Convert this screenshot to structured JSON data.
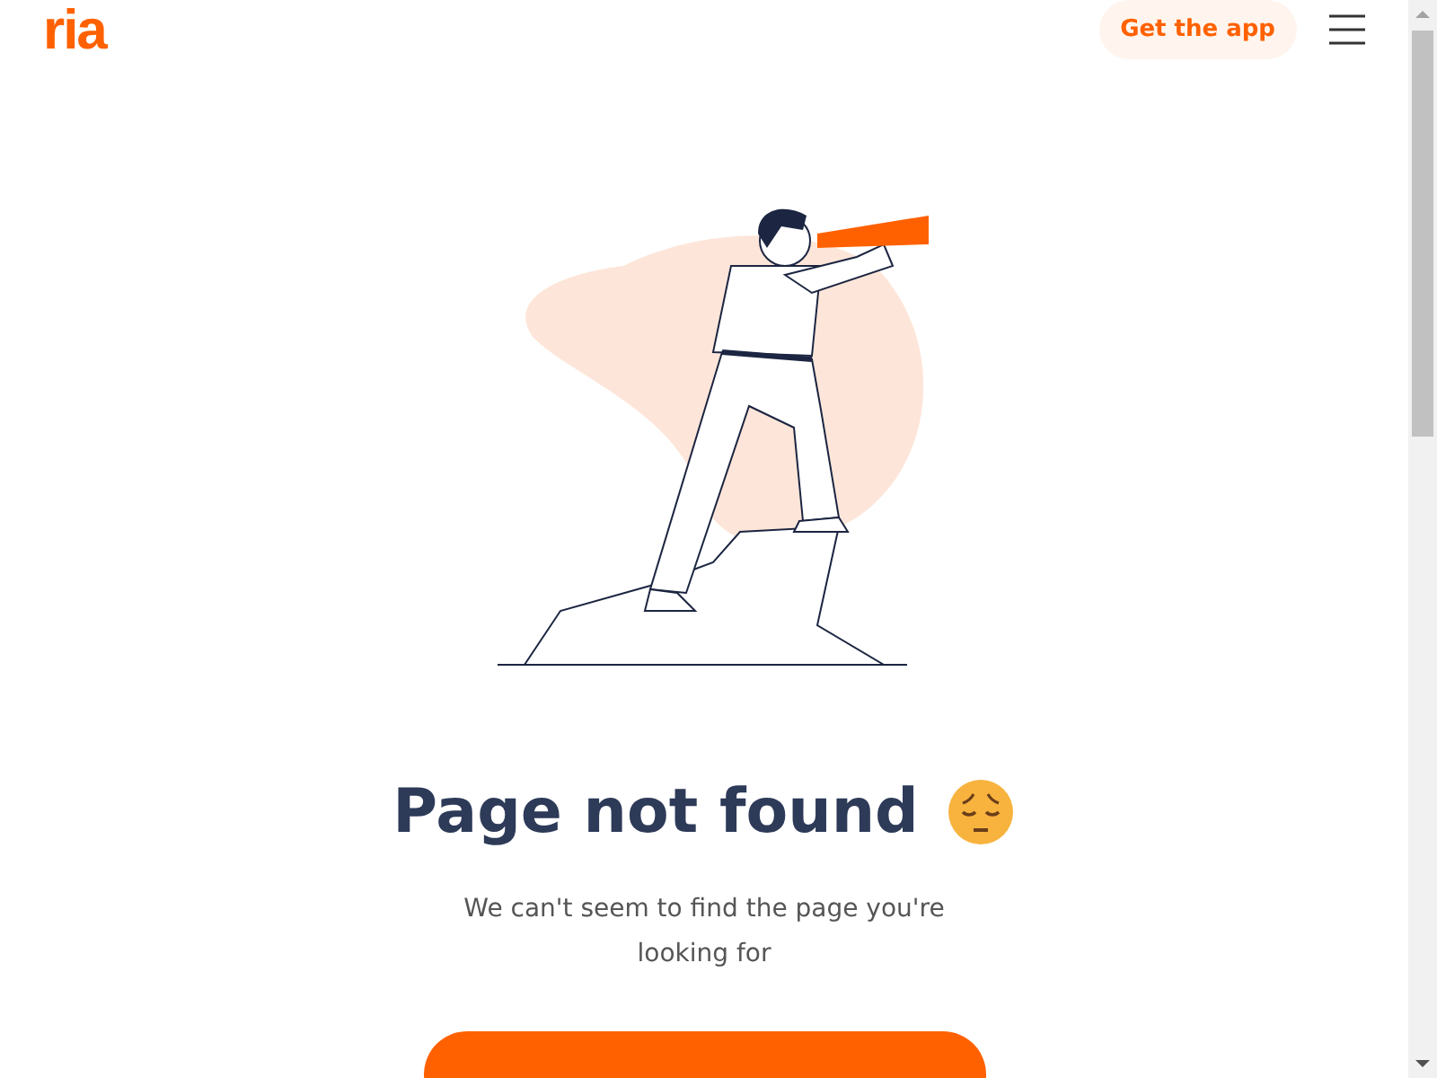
{
  "header": {
    "logo": "ria",
    "cta": "Get the app"
  },
  "error": {
    "title": "Page not found",
    "message": "We can't seem to find the page you're looking for"
  }
}
